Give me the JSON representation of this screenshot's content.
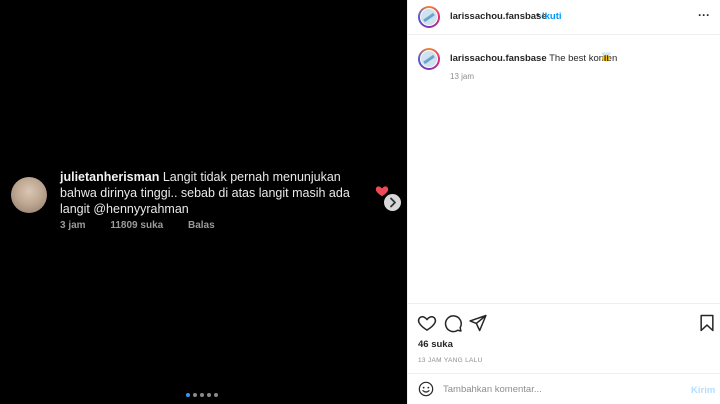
{
  "media": {
    "comment": {
      "username": "julietanherisman",
      "text": "Langit tidak pernah menunjukan bahwa dirinya tinggi.. sebab di atas langit masih ada langit @hennyyrahman",
      "time": "3 jam",
      "likes": "11809 suka",
      "reply": "Balas"
    },
    "carousel": {
      "count": 5,
      "active_index": 0
    }
  },
  "header": {
    "username": "larissachou.fansbase",
    "separator": "•",
    "follow_label": "Ikuti",
    "more_label": "···"
  },
  "caption": {
    "username": "larissachou.fansbase",
    "text": "The best komen",
    "time": "13 jam"
  },
  "actions": {
    "likes": "46 suka",
    "timestamp": "13 JAM YANG LALU"
  },
  "comment_box": {
    "placeholder": "Tambahkan komentar...",
    "post_label": "Kirim"
  },
  "colors": {
    "accent": "#0095f6",
    "heart": "#ed4956",
    "carousel_active": "#3897f0"
  }
}
